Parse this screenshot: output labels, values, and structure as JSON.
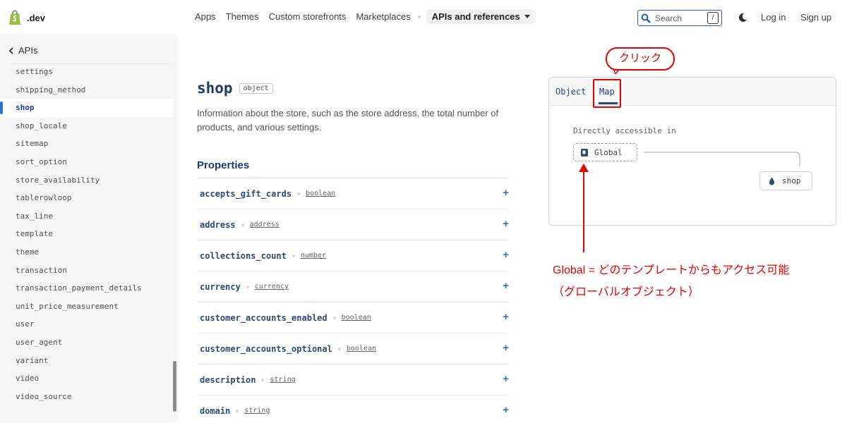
{
  "brand": {
    "name": ".dev",
    "icon": "shopify-bag-icon",
    "accent": "#95bf47"
  },
  "nav": {
    "items": [
      "Apps",
      "Themes",
      "Custom storefronts",
      "Marketplaces"
    ],
    "active": "APIs and references",
    "search_placeholder": "Search",
    "search_shortcut": "/",
    "login": "Log in",
    "signup": "Sign up"
  },
  "sidebar": {
    "back_label": "APIs",
    "items": [
      "settings",
      "shipping_method",
      "shop",
      "shop_locale",
      "sitemap",
      "sort_option",
      "store_availability",
      "tablerowloop",
      "tax_line",
      "template",
      "theme",
      "transaction",
      "transaction_payment_details",
      "unit_price_measurement",
      "user",
      "user_agent",
      "variant",
      "video",
      "video_source"
    ],
    "active_item": "shop"
  },
  "main": {
    "title": "shop",
    "badge": "object",
    "description": "Information about the store, such as the store address, the total number of products, and various settings.",
    "properties_title": "Properties",
    "properties": [
      {
        "name": "accepts_gift_cards",
        "type": "boolean"
      },
      {
        "name": "address",
        "type": "address"
      },
      {
        "name": "collections_count",
        "type": "number"
      },
      {
        "name": "currency",
        "type": "currency"
      },
      {
        "name": "customer_accounts_enabled",
        "type": "boolean"
      },
      {
        "name": "customer_accounts_optional",
        "type": "boolean"
      },
      {
        "name": "description",
        "type": "string"
      },
      {
        "name": "domain",
        "type": "string"
      }
    ],
    "expand_symbol": "+"
  },
  "panel": {
    "tabs": [
      "Object",
      "Map"
    ],
    "active_tab": "Map",
    "map_label": "Directly accessible in",
    "node_global": "Global",
    "node_shop": "shop"
  },
  "annotations": {
    "click_label": "クリック",
    "note_line1": "Global = どのテンプレートからもアクセス可能",
    "note_line2": "（グローバルオブジェクト）",
    "color": "#e60000"
  }
}
